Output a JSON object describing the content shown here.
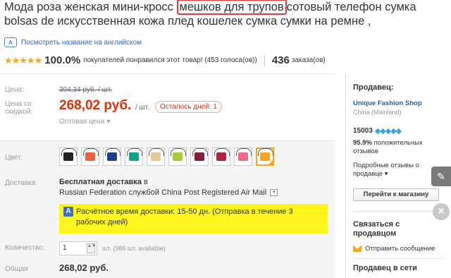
{
  "title": {
    "part1": "Мода роза женская мини-кросс ",
    "highlight": "мешков для трупов",
    "part2": "сотовый телефон сумка bolsas de искусственная кожа плед кошелек сумка сумки на ремне ,"
  },
  "translate_link": "Посмотреть название на английском",
  "translate_icon": "translate-icon",
  "rating": {
    "stars": "★★★★★",
    "percent": "100.0%",
    "text": "покупателей понравился этот товар! (453 голоса(ов))",
    "orders_count": "436",
    "orders_label": "заказа(ов)"
  },
  "price": {
    "label": "Цена:",
    "old": "304,34 руб. / шт.",
    "discount_label": "Цена со скидкой:",
    "new": "268,02 руб.",
    "unit": "/ шт.",
    "days_left": "Осталось дней: 1",
    "wholesale": "Оптовая цена ▾"
  },
  "options": {
    "color_label": "Цвет:",
    "colors": [
      "#222222",
      "#e8643c",
      "#1f3f8a",
      "#16a383",
      "#e5c89a",
      "#a9c93a",
      "#8a1f3a",
      "#b0243e",
      "#ef6b8a",
      "#f5a623"
    ],
    "delivery_label": "Доставка:",
    "free_shipping": "Бесплатная доставка",
    "in": "в",
    "ship_route": "Russian Federation службой China Post Registered Air Mail",
    "dropdown_glyph": "▾",
    "delivery_badge": "A",
    "delivery_time": "Расчётное время доставки: 15-50 дн. (Отправка в течение 3 рабочих дней)",
    "quantity_label": "Количество:",
    "quantity_value": "1",
    "stepper_glyph": "▲▼",
    "available": "шт. (986 шт. available)",
    "total_label": "Общая",
    "total_value": "268,02 руб."
  },
  "seller": {
    "heading": "Продавец:",
    "shop_name": "Unique Fashion Shop",
    "country": "China (Mainland)",
    "score": "15003",
    "diamonds": "◆◆◆◆◆",
    "positive_pct": "95.9%",
    "positive_text": "положительных отзывов",
    "details": "Подробные отзывы о продавце ▾",
    "store_button": "Перейти к магазину",
    "contact_heading": "Связаться с продавцом",
    "message_link": "Отправить сообщение",
    "online_heading": "Продавец в сети"
  },
  "fab": {
    "edit_glyph": "✎",
    "close_glyph": "×"
  }
}
